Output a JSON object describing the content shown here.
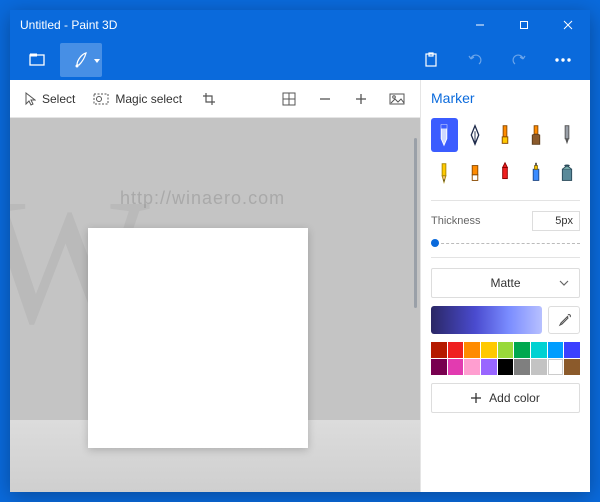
{
  "window": {
    "title": "Untitled - Paint 3D"
  },
  "toolbar": {
    "select": "Select",
    "magic_select": "Magic select"
  },
  "panel": {
    "heading": "Marker",
    "tools": [
      "marker",
      "calligraphy-pen",
      "oil-brush",
      "spray-can",
      "watercolor",
      "pencil",
      "eraser",
      "crayon",
      "pixel-pen",
      "fill"
    ],
    "selected_tool": 0,
    "thickness_label": "Thickness",
    "thickness_value": "5px",
    "material_label": "Matte",
    "add_color_label": "Add color",
    "swatches": [
      "#b51a00",
      "#ef2020",
      "#ff8b00",
      "#ffc900",
      "#99d93a",
      "#00a84f",
      "#00d2d2",
      "#009dff",
      "#3b40ff",
      "#78004f",
      "#e23bb0",
      "#ff9ed0",
      "#9966ff",
      "#000000",
      "#7f7f7f",
      "#c3c3c3",
      "#ffffff",
      "#8b5a2b"
    ]
  },
  "watermark": {
    "text1": "http://winaero.com",
    "text2": "http://winaero.com",
    "big": "W"
  }
}
